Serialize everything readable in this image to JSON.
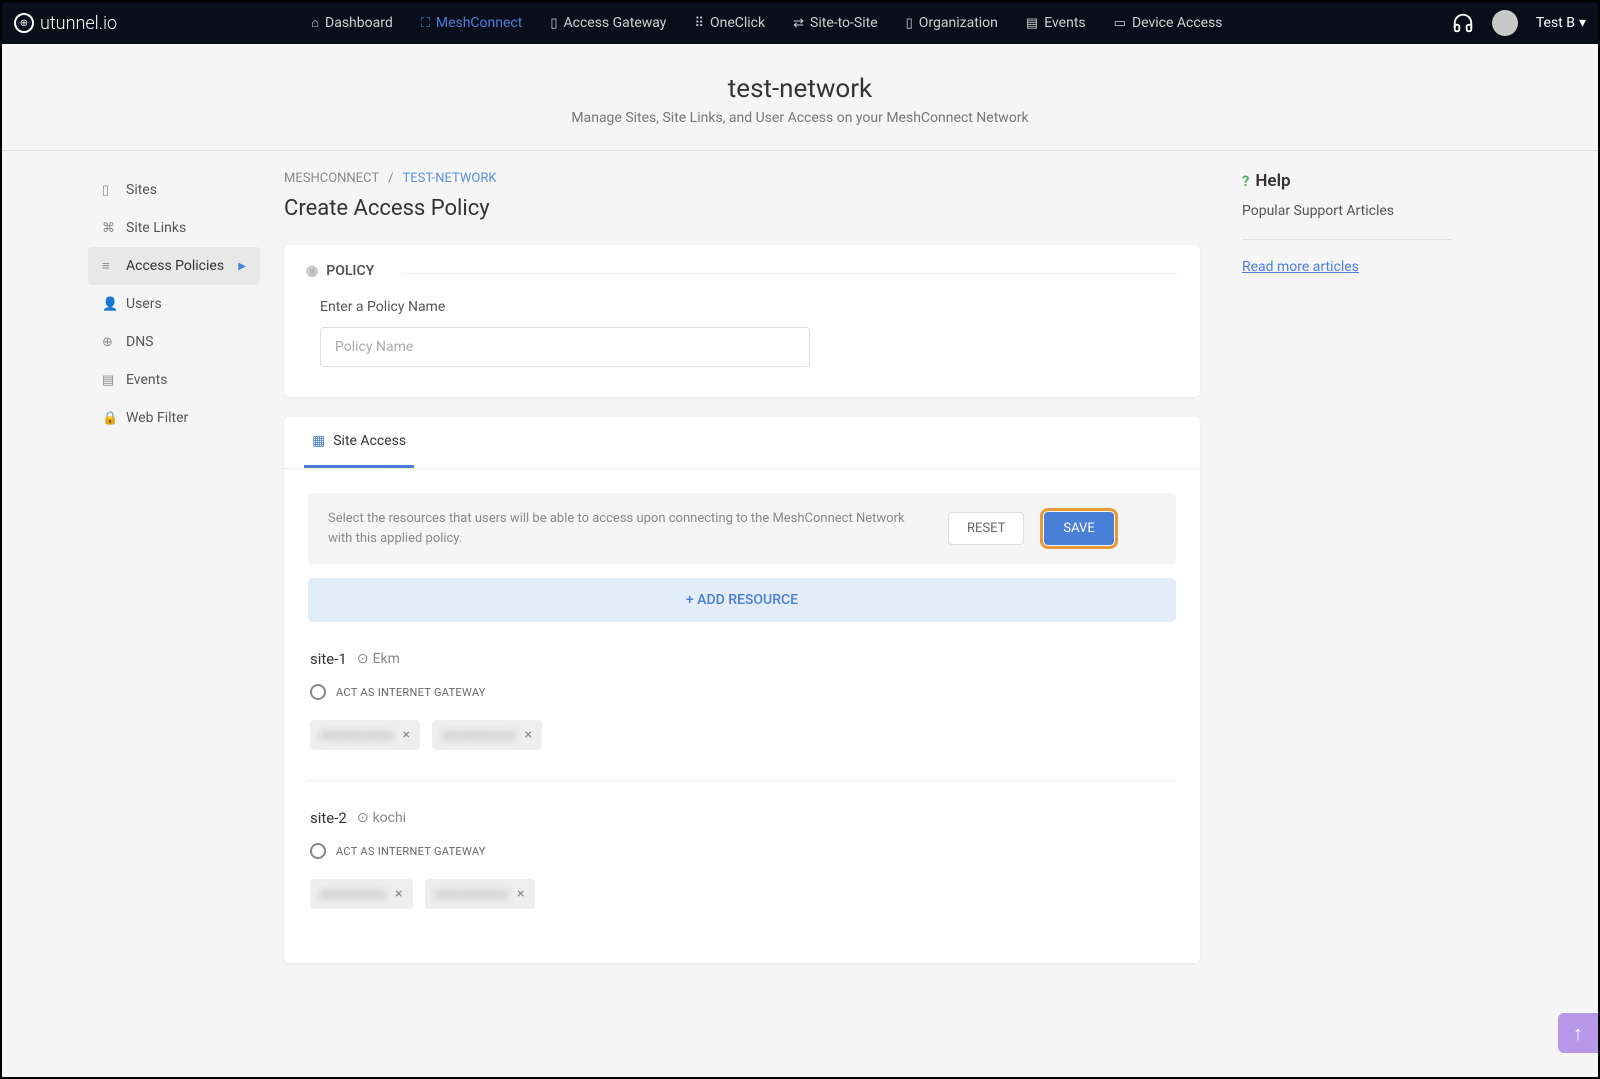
{
  "logo": "utunnel.io",
  "nav": [
    {
      "label": "Dashboard",
      "icon": "⌂"
    },
    {
      "label": "MeshConnect",
      "icon": "⛶"
    },
    {
      "label": "Access Gateway",
      "icon": "▯"
    },
    {
      "label": "OneClick",
      "icon": "⠿"
    },
    {
      "label": "Site-to-Site",
      "icon": "⇄"
    },
    {
      "label": "Organization",
      "icon": "▯"
    },
    {
      "label": "Events",
      "icon": "▤"
    },
    {
      "label": "Device Access",
      "icon": "▭"
    }
  ],
  "user": "Test B",
  "header": {
    "title": "test-network",
    "subtitle": "Manage Sites, Site Links, and User Access on your MeshConnect Network"
  },
  "sidebar": [
    {
      "label": "Sites",
      "icon": "▯"
    },
    {
      "label": "Site Links",
      "icon": "⌘"
    },
    {
      "label": "Access Policies",
      "icon": "≡"
    },
    {
      "label": "Users",
      "icon": "👤"
    },
    {
      "label": "DNS",
      "icon": "⊕"
    },
    {
      "label": "Events",
      "icon": "▤"
    },
    {
      "label": "Web Filter",
      "icon": "🔒"
    }
  ],
  "breadcrumb": {
    "root": "MESHCONNECT",
    "current": "TEST-NETWORK"
  },
  "content_title": "Create Access Policy",
  "policy": {
    "section_label": "POLICY",
    "field_label": "Enter a Policy Name",
    "placeholder": "Policy Name"
  },
  "site_access": {
    "tab_label": "Site Access",
    "info": "Select the resources that users will be able to access upon connecting to the MeshConnect Network with this applied policy.",
    "reset": "RESET",
    "save": "SAVE",
    "add_resource": "+ ADD RESOURCE",
    "sites": [
      {
        "name": "site-1",
        "location": "Ekm",
        "gateway_label": "ACT AS INTERNET GATEWAY",
        "tags": [
          "xxxxxxxxxx",
          "xxxxxxxxxx"
        ]
      },
      {
        "name": "site-2",
        "location": "kochi",
        "gateway_label": "ACT AS INTERNET GATEWAY",
        "tags": [
          "xxxxxxxxx",
          "xxxxxxxxxx"
        ]
      }
    ]
  },
  "help": {
    "title": "Help",
    "subtitle": "Popular Support Articles",
    "link": "Read more articles"
  }
}
